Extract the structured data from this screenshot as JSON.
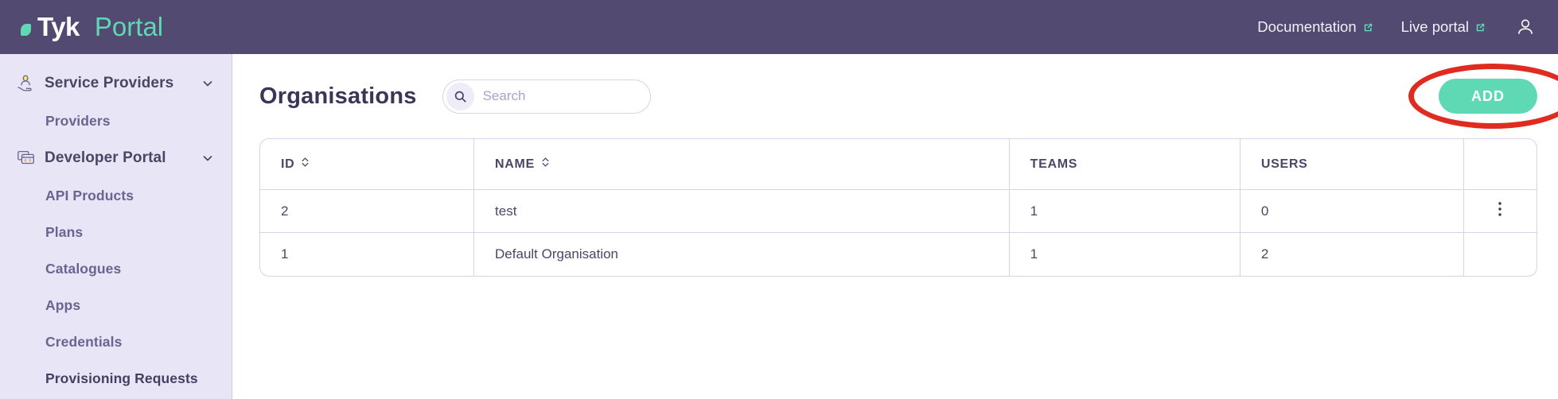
{
  "brand": {
    "dot": "leaf-dot",
    "name": "Tyk",
    "product": "Portal"
  },
  "topnav": {
    "documentation": "Documentation",
    "live_portal": "Live portal",
    "account_icon": "user-avatar-icon"
  },
  "sidebar": {
    "groups": [
      {
        "label": "Service Providers",
        "icon": "service-providers-icon",
        "chevron": "chevron-down-icon",
        "items": [
          {
            "label": "Providers",
            "active": false
          }
        ]
      },
      {
        "label": "Developer Portal",
        "icon": "developer-portal-icon",
        "chevron": "chevron-down-icon",
        "items": [
          {
            "label": "API Products",
            "active": false
          },
          {
            "label": "Plans",
            "active": false
          },
          {
            "label": "Catalogues",
            "active": false
          },
          {
            "label": "Apps",
            "active": false
          },
          {
            "label": "Credentials",
            "active": false
          },
          {
            "label": "Provisioning Requests",
            "active": true
          }
        ]
      }
    ]
  },
  "page": {
    "title": "Organisations",
    "search": {
      "icon": "search-icon",
      "value": "",
      "placeholder": "Search"
    },
    "add_button": {
      "label": "ADD",
      "color": "#5fd9b4"
    },
    "annotation": {
      "shape": "ellipse",
      "color": "#e02b20",
      "target": "add-button"
    }
  },
  "table": {
    "columns": [
      {
        "key": "id",
        "label": "ID",
        "sortable": true,
        "sort_icon": "sort-chevrons-icon"
      },
      {
        "key": "name",
        "label": "NAME",
        "sortable": true,
        "sort_icon": "sort-chevrons-icon"
      },
      {
        "key": "teams",
        "label": "TEAMS",
        "sortable": false
      },
      {
        "key": "users",
        "label": "USERS",
        "sortable": false
      },
      {
        "key": "actions",
        "label": "",
        "sortable": false
      }
    ],
    "rows": [
      {
        "id": "2",
        "name": "test",
        "teams": "1",
        "users": "0",
        "menu": "kebab-menu-icon",
        "has_menu": true
      },
      {
        "id": "1",
        "name": "Default Organisation",
        "teams": "1",
        "users": "2",
        "menu": "",
        "has_menu": false
      }
    ]
  },
  "colors": {
    "topbar": "#524a70",
    "sidebar": "#e8e5f7",
    "accent_teal": "#5fd9b4",
    "annotation_red": "#e02b20",
    "text_purple": "#4b4566",
    "border": "#d6d1ef"
  }
}
